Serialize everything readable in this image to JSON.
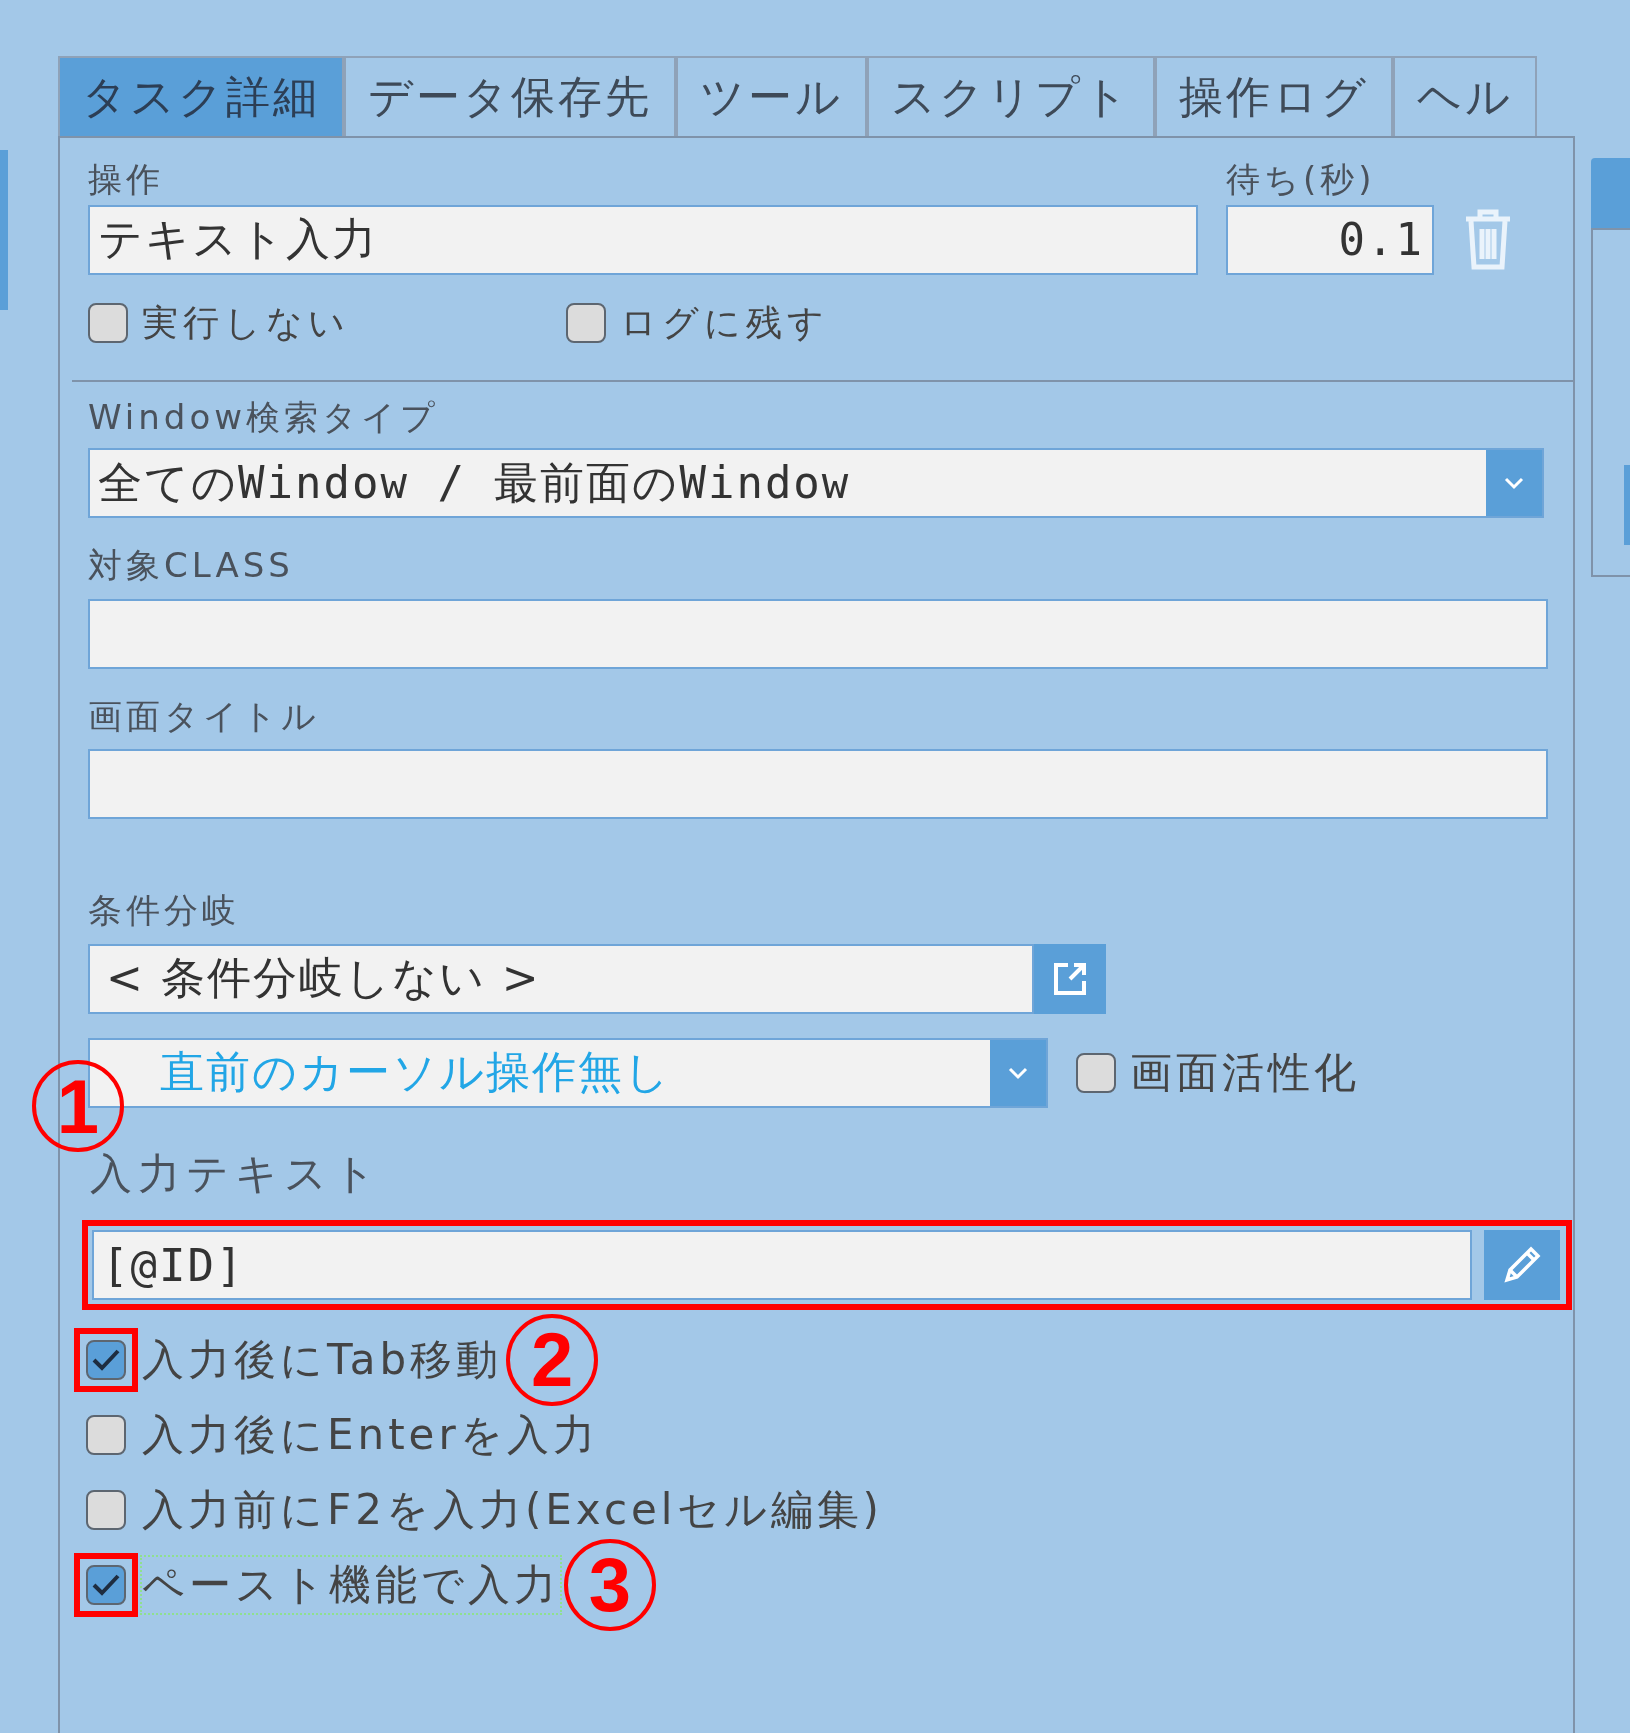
{
  "tabs": [
    {
      "label": "タスク詳細",
      "selected": true
    },
    {
      "label": "データ保存先",
      "selected": false
    },
    {
      "label": "ツール",
      "selected": false
    },
    {
      "label": "スクリプト",
      "selected": false
    },
    {
      "label": "操作ログ",
      "selected": false
    },
    {
      "label": "ヘル",
      "selected": false
    }
  ],
  "operation": {
    "label": "操作",
    "value": "テキスト入力"
  },
  "wait": {
    "label": "待ち(秒)",
    "value": "0.1"
  },
  "options": [
    {
      "label": "実行しない",
      "checked": false
    },
    {
      "label": "ログに残す",
      "checked": false
    }
  ],
  "window_search_type": {
    "label": "Window検索タイプ",
    "value": "全てのWindow / 最前面のWindow"
  },
  "target_class": {
    "label": "対象CLASS"
  },
  "screen_title": {
    "label": "画面タイトル"
  },
  "condition": {
    "label": "条件分岐",
    "value": "< 条件分岐しない >"
  },
  "cursor_select": {
    "value": "直前のカーソル操作無し"
  },
  "activate": {
    "label": "画面活性化",
    "checked": false
  },
  "input_text": {
    "label": "入力テキスト",
    "value": "[@ID]",
    "highlighted": true,
    "annotation": "1"
  },
  "input_options": [
    {
      "label": "入力後にTab移動",
      "checked": true,
      "highlighted": true,
      "annotation": "2",
      "focused": false
    },
    {
      "label": "入力後にEnterを入力",
      "checked": false,
      "focused": false
    },
    {
      "label": "入力前にF2を入力(Excelセル編集)",
      "checked": false,
      "focused": false
    },
    {
      "label": "ペースト機能で入力",
      "checked": true,
      "highlighted": true,
      "annotation": "3",
      "focused": true
    }
  ]
}
